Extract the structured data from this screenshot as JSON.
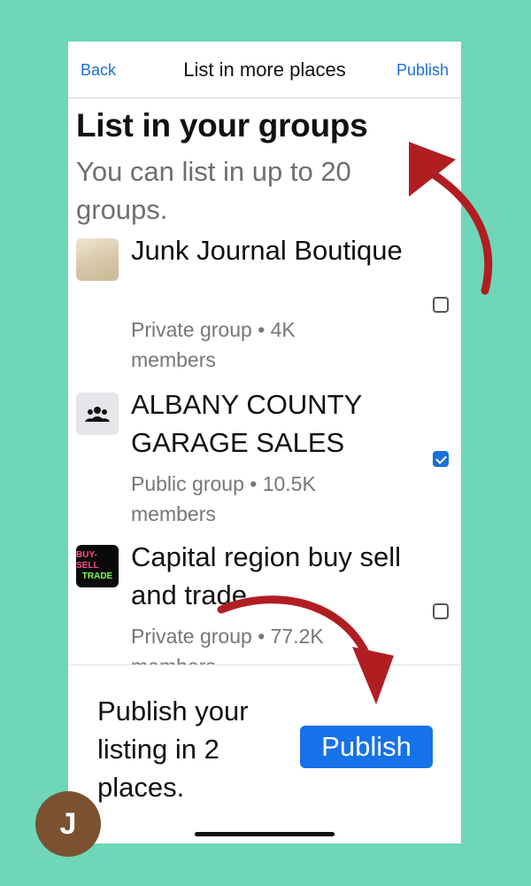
{
  "header": {
    "back_label": "Back",
    "title": "List in more places",
    "publish_label": "Publish"
  },
  "section": {
    "heading": "List in your groups",
    "subheading": "You can list in up to 20 groups."
  },
  "groups": [
    {
      "name": "Junk Journal Boutique",
      "meta": "Private group • 4K members",
      "checked": false,
      "icon": "junk-journal-thumbnail"
    },
    {
      "name": "ALBANY COUNTY GARAGE SALES",
      "meta": "Public group • 10.5K members",
      "checked": true,
      "icon": "people-group-icon"
    },
    {
      "name": "Capital region buy sell and trade",
      "meta": "Private group • 77.2K members",
      "checked": false,
      "icon": "buy-sell-trade-logo",
      "logo_text": [
        "BUY-SELL",
        "TRADE"
      ]
    }
  ],
  "footer": {
    "message": "Publish your listing in 2 places.",
    "publish_button": "Publish"
  },
  "avatar": {
    "letter": "J"
  },
  "colors": {
    "background": "#6fd6b8",
    "accent": "#1672e8",
    "arrow": "#b01e22"
  }
}
